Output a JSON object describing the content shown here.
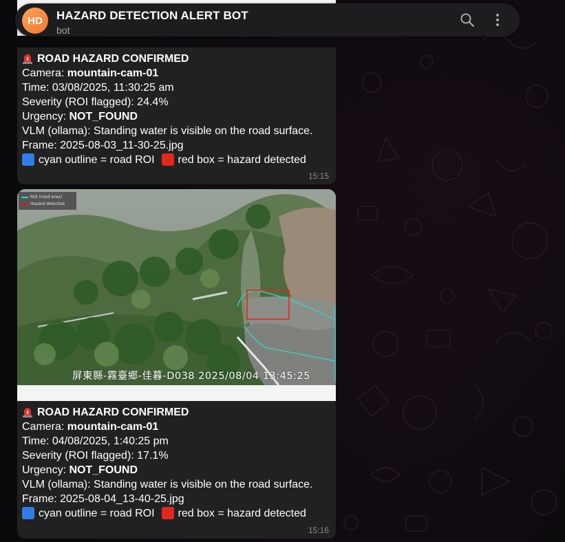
{
  "header": {
    "avatar_initials": "HD",
    "title": "HAZARD DETECTION ALERT BOT",
    "subtitle": "bot",
    "icons": [
      "search-icon",
      "more-vertical-icon"
    ]
  },
  "colors": {
    "avatar": "#f27a2f",
    "bubble": "#212121",
    "roi_outline": "#33d6d6",
    "hazard_box": "#e0281e"
  },
  "messages": [
    {
      "heading": "ROAD HAZARD CONFIRMED",
      "camera_label": "Camera: ",
      "camera": "mountain-cam-01",
      "time_line": "Time: 03/08/2025, 11:30:25 am",
      "severity_line": "Severity (ROI flagged): 24.4%",
      "urgency_label": "Urgency: ",
      "urgency": "NOT_FOUND",
      "vlm_line": "VLM (ollama): Standing water is visible on the road surface.",
      "frame_line": "Frame: 2025-08-03_11-30-25.jpg",
      "legend_roi": "cyan outline = road ROI",
      "legend_hazard": "red box = hazard detected",
      "sent_time": "15:15"
    },
    {
      "photo": {
        "legend_roi": "ROI (road area)",
        "legend_hazard": "Hazard detected",
        "cam_stamp": "屏東縣-霧臺鄉-佳暮-D038    2025/08/04 13:45:25"
      },
      "heading": "ROAD HAZARD CONFIRMED",
      "camera_label": "Camera: ",
      "camera": "mountain-cam-01",
      "time_line": "Time: 04/08/2025, 1:40:25 pm",
      "severity_line": "Severity (ROI flagged): 17.1%",
      "urgency_label": "Urgency: ",
      "urgency": "NOT_FOUND",
      "vlm_line": "VLM (ollama): Standing water is visible on the road surface.",
      "frame_line": "Frame: 2025-08-04_13-40-25.jpg",
      "legend_roi": "cyan outline = road ROI",
      "legend_hazard": "red box = hazard detected",
      "sent_time": "15:16"
    }
  ]
}
